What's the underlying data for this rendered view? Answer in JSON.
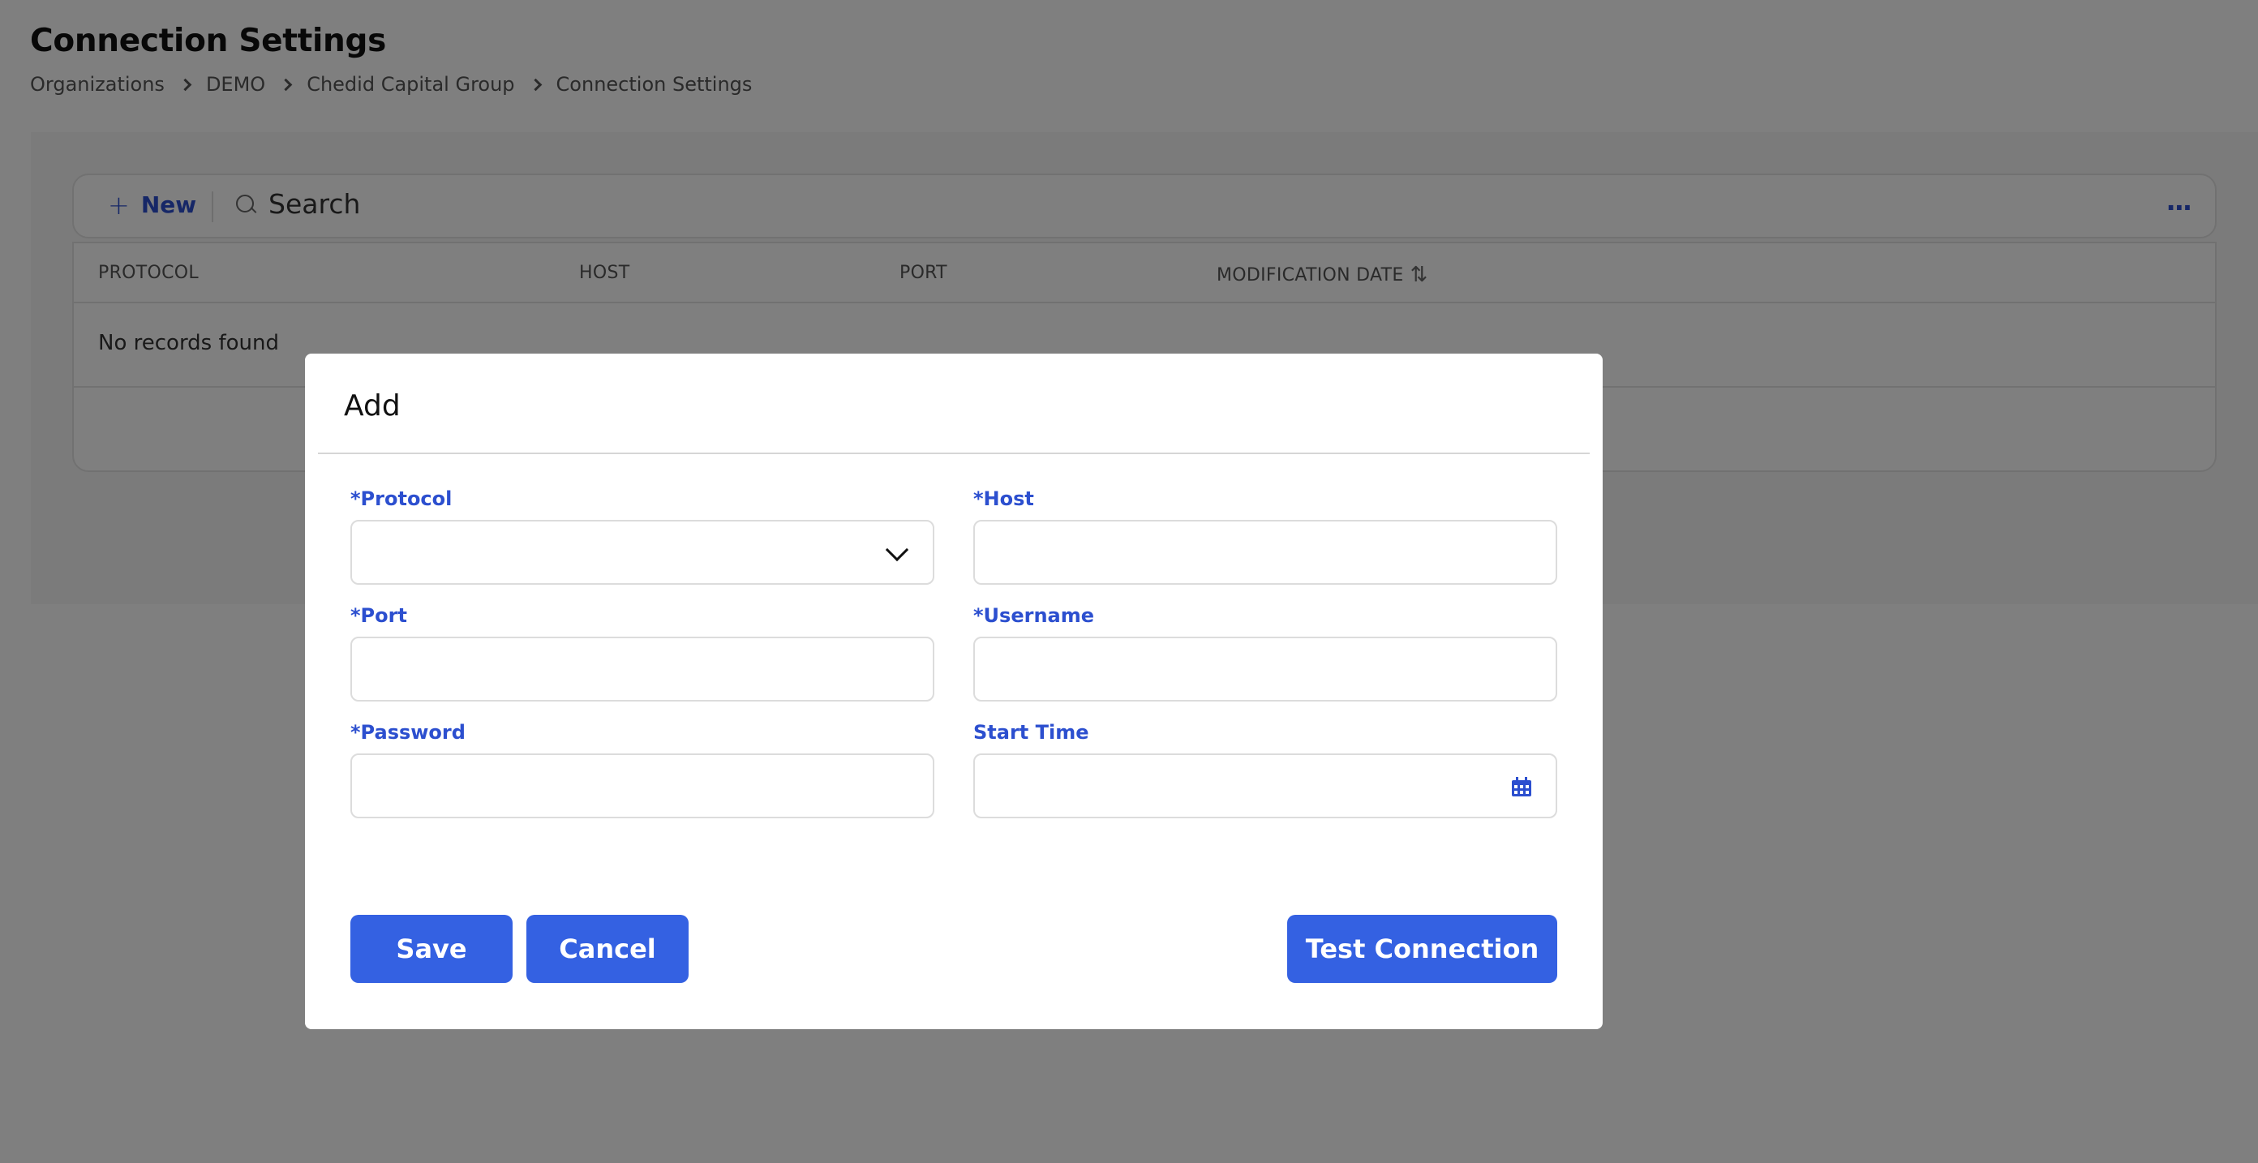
{
  "page": {
    "title": "Connection Settings",
    "breadcrumb": [
      "Organizations",
      "DEMO",
      "Chedid Capital Group",
      "Connection Settings"
    ]
  },
  "toolbar": {
    "new_label": "New",
    "search_placeholder": "Search",
    "more_icon": "more-horizontal-icon"
  },
  "table": {
    "columns": [
      "PROTOCOL",
      "HOST",
      "PORT",
      "MODIFICATION DATE"
    ],
    "empty_text": "No records found"
  },
  "modal": {
    "title": "Add",
    "fields": {
      "protocol": {
        "label": "*Protocol",
        "value": ""
      },
      "host": {
        "label": "*Host",
        "value": ""
      },
      "port": {
        "label": "*Port",
        "value": ""
      },
      "username": {
        "label": "*Username",
        "value": ""
      },
      "password": {
        "label": "*Password",
        "value": ""
      },
      "start_time": {
        "label": "Start Time",
        "value": ""
      }
    },
    "buttons": {
      "save": "Save",
      "cancel": "Cancel",
      "test": "Test Connection"
    }
  },
  "colors": {
    "accent": "#3461e2",
    "label": "#2c4fcf",
    "overlay": "rgba(0,0,0,0.5)"
  }
}
